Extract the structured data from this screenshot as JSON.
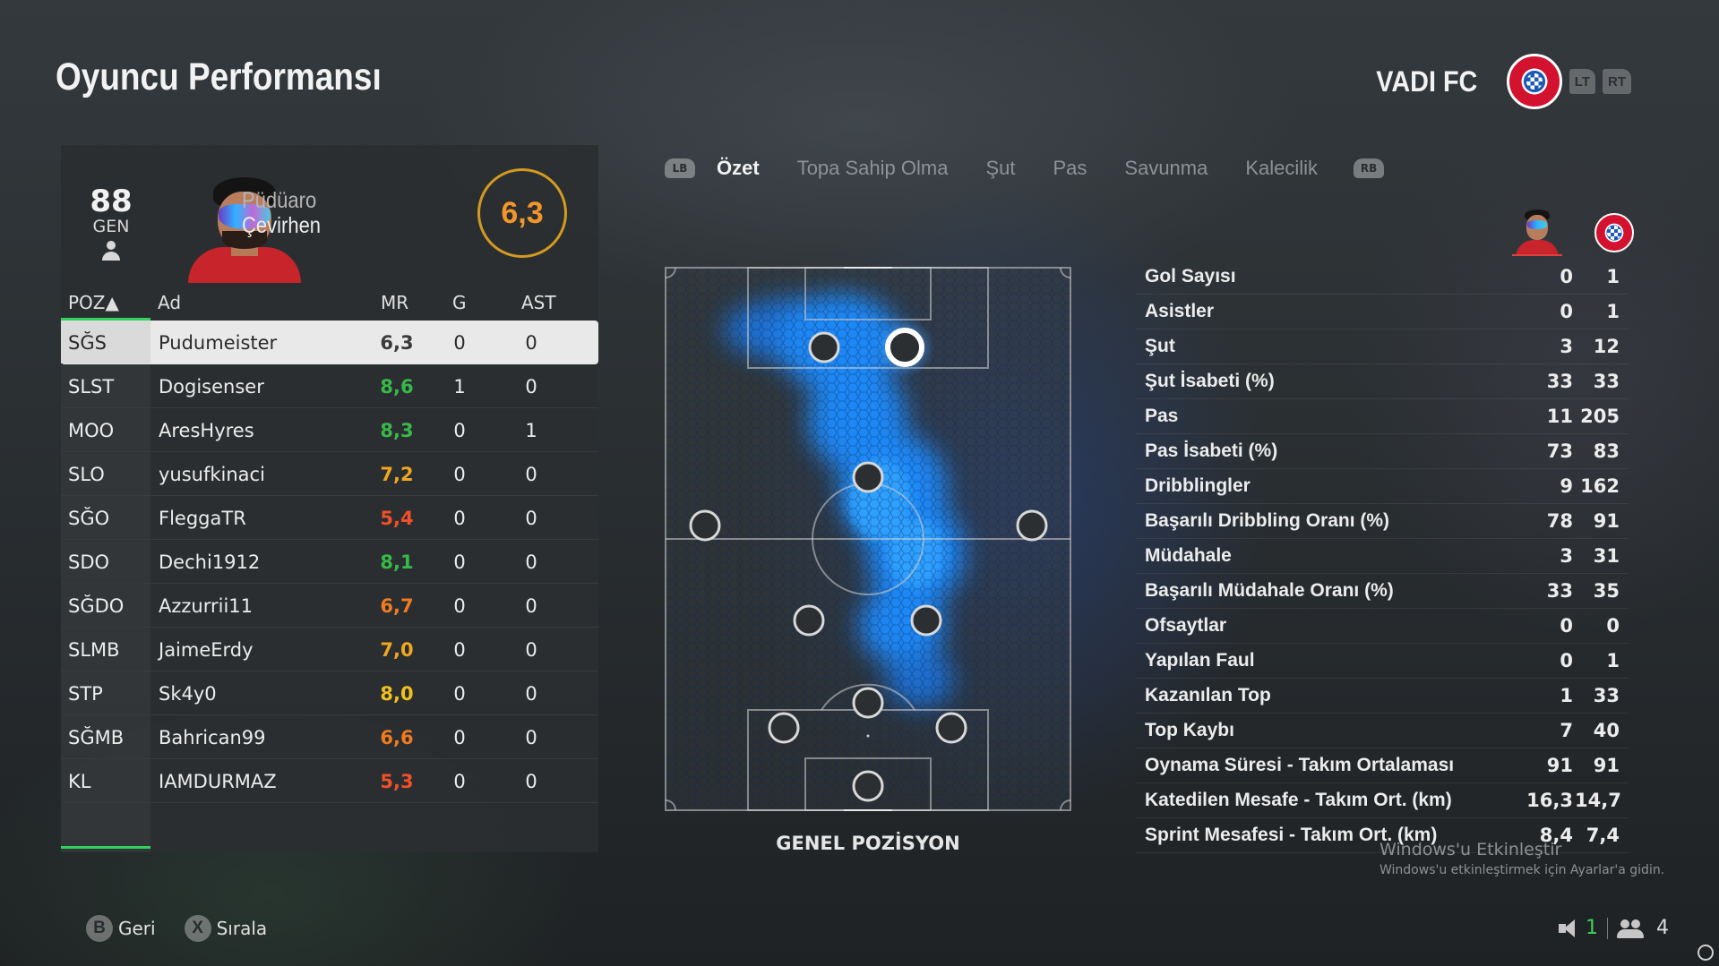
{
  "page": {
    "title": "Oyuncu Performansı"
  },
  "team": {
    "name": "VADI FC",
    "lt": "LT",
    "rt": "RT"
  },
  "player": {
    "overall": "88",
    "overall_label": "GEN",
    "first_name": "Püdüaro",
    "last_name": "Çevirhen",
    "rating": "6,3"
  },
  "table": {
    "headers": {
      "pos": "POZ▲",
      "name": "Ad",
      "mr": "MR",
      "g": "G",
      "ast": "AST"
    },
    "rows": [
      {
        "pos": "SĞS",
        "name": "Pudumeister",
        "mr": "6,3",
        "mr_color": "#3a3a3a",
        "g": "0",
        "ast": "0"
      },
      {
        "pos": "SLST",
        "name": "Dogisenser",
        "mr": "8,6",
        "mr_color": "#39b84a",
        "g": "1",
        "ast": "0"
      },
      {
        "pos": "MOO",
        "name": "AresHyres",
        "mr": "8,3",
        "mr_color": "#39b84a",
        "g": "0",
        "ast": "1"
      },
      {
        "pos": "SLO",
        "name": "yusufkinaci",
        "mr": "7,2",
        "mr_color": "#f0a61e",
        "g": "0",
        "ast": "0"
      },
      {
        "pos": "SĞO",
        "name": "FleggaTR",
        "mr": "5,4",
        "mr_color": "#f0502a",
        "g": "0",
        "ast": "0"
      },
      {
        "pos": "SDO",
        "name": "Dechi1912",
        "mr": "8,1",
        "mr_color": "#39b84a",
        "g": "0",
        "ast": "0"
      },
      {
        "pos": "SĞDO",
        "name": "Azzurrii11",
        "mr": "6,7",
        "mr_color": "#f07a22",
        "g": "0",
        "ast": "0"
      },
      {
        "pos": "SLMB",
        "name": "JaimeErdy",
        "mr": "7,0",
        "mr_color": "#f0a61e",
        "g": "0",
        "ast": "0"
      },
      {
        "pos": "STP",
        "name": "Sk4y0",
        "mr": "8,0",
        "mr_color": "#f0c01e",
        "g": "0",
        "ast": "0"
      },
      {
        "pos": "SĞMB",
        "name": "Bahrican99",
        "mr": "6,6",
        "mr_color": "#f07a22",
        "g": "0",
        "ast": "0"
      },
      {
        "pos": "KL",
        "name": "IAMDURMAZ",
        "mr": "5,3",
        "mr_color": "#f0502a",
        "g": "0",
        "ast": "0"
      }
    ]
  },
  "tabs": {
    "lb": "LB",
    "rb": "RB",
    "items": [
      "Özet",
      "Topa Sahip Olma",
      "Şut",
      "Pas",
      "Savunma",
      "Kalecilik"
    ],
    "active": "Özet"
  },
  "pitch": {
    "caption": "GENEL POZİSYON"
  },
  "stats": [
    {
      "label": "Gol Sayısı",
      "player": "0",
      "team": "1"
    },
    {
      "label": "Asistler",
      "player": "0",
      "team": "1"
    },
    {
      "label": "Şut",
      "player": "3",
      "team": "12"
    },
    {
      "label": "Şut İsabeti (%)",
      "player": "33",
      "team": "33"
    },
    {
      "label": "Pas",
      "player": "11",
      "team": "205"
    },
    {
      "label": "Pas İsabeti (%)",
      "player": "73",
      "team": "83"
    },
    {
      "label": "Dribblingler",
      "player": "9",
      "team": "162"
    },
    {
      "label": "Başarılı Dribbling Oranı (%)",
      "player": "78",
      "team": "91"
    },
    {
      "label": "Müdahale",
      "player": "3",
      "team": "31"
    },
    {
      "label": "Başarılı Müdahale Oranı (%)",
      "player": "33",
      "team": "35"
    },
    {
      "label": "Ofsaytlar",
      "player": "0",
      "team": "0"
    },
    {
      "label": "Yapılan Faul",
      "player": "0",
      "team": "1"
    },
    {
      "label": "Kazanılan Top",
      "player": "1",
      "team": "33"
    },
    {
      "label": "Top Kaybı",
      "player": "7",
      "team": "40"
    },
    {
      "label": "Oynama Süresi - Takım Ortalaması",
      "player": "91",
      "team": "91"
    },
    {
      "label": "Katedilen Mesafe - Takım Ort. (km)",
      "player": "16,3",
      "team": "14,7"
    },
    {
      "label": "Sprint Mesafesi - Takım Ort. (km)",
      "player": "8,4",
      "team": "7,4"
    }
  ],
  "watermark": {
    "line1": "Windows'u Etkinleştir",
    "line2": "Windows'u etkinleştirmek için Ayarlar'a gidin."
  },
  "footer": {
    "back_key": "B",
    "back_label": "Geri",
    "sort_key": "X",
    "sort_label": "Sırala",
    "voice_count": "1",
    "party_count": "4"
  },
  "colors": {
    "accent_green": "#2fd35c",
    "rating_ring": "#d39a20",
    "heatmap": "#1a8cff"
  },
  "icons": [
    "person-icon",
    "crest-icon",
    "mic-icon",
    "people-icon"
  ]
}
